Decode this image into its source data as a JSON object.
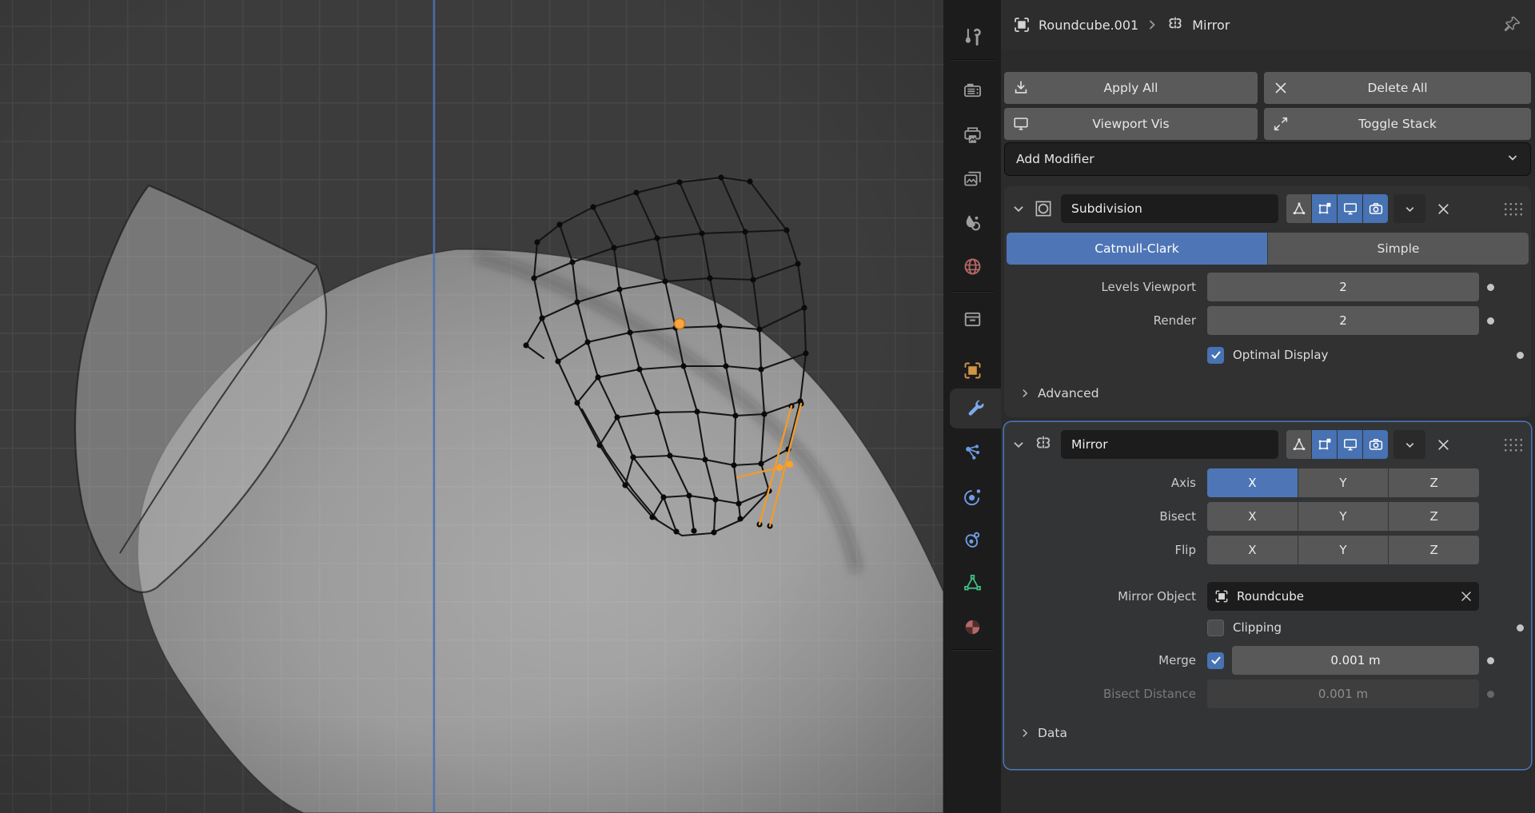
{
  "properties_header": {
    "object_name": "Roundcube.001",
    "modifier_name": "Mirror"
  },
  "actions": {
    "apply_all": "Apply All",
    "delete_all": "Delete All",
    "viewport_vis": "Viewport Vis",
    "toggle_stack": "Toggle Stack"
  },
  "add_modifier": {
    "label": "Add Modifier"
  },
  "subdivision": {
    "name": "Subdivision",
    "catmull_clark": "Catmull-Clark",
    "simple": "Simple",
    "levels_viewport_label": "Levels Viewport",
    "levels_viewport_value": "2",
    "render_label": "Render",
    "render_value": "2",
    "optimal_display_label": "Optimal Display",
    "advanced_label": "Advanced"
  },
  "mirror": {
    "name": "Mirror",
    "axis_label": "Axis",
    "bisect_label": "Bisect",
    "flip_label": "Flip",
    "x": "X",
    "y": "Y",
    "z": "Z",
    "axis_selected": "X",
    "mirror_object_label": "Mirror Object",
    "mirror_object_value": "Roundcube",
    "clipping_label": "Clipping",
    "merge_label": "Merge",
    "merge_value": "0.001 m",
    "bisect_distance_label": "Bisect Distance",
    "bisect_distance_value": "0.001 m",
    "data_label": "Data"
  },
  "sidebar_icons": [
    "tool-icon",
    "render-icon",
    "output-icon",
    "view-layer-icon",
    "scene-icon",
    "world-icon",
    "collection-icon",
    "object-icon",
    "modifiers-wrench-icon",
    "particles-icon",
    "physics-icon",
    "constraints-icon",
    "object-data-icon",
    "material-icon"
  ],
  "sidebar_active_tab": "modifiers",
  "colors": {
    "accent_blue": "#4772b3",
    "selection_orange": "#ff9a1e",
    "axis_blue": "#4a72b0",
    "object_orange": "#d19545",
    "data_green": "#41bd83",
    "world_red": "#b46767"
  }
}
